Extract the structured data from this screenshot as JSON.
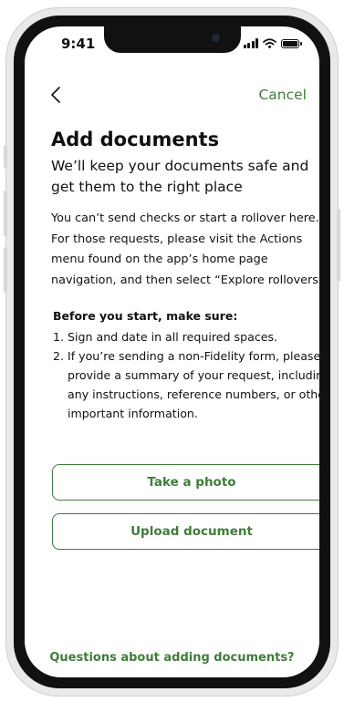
{
  "status_bar": {
    "time": "9:41",
    "icons": [
      "cellular-signal-icon",
      "wifi-icon",
      "battery-icon"
    ]
  },
  "nav": {
    "back_icon": "chevron-left-icon",
    "cancel_label": "Cancel"
  },
  "header": {
    "title": "Add documents",
    "subtitle": "We’ll keep your documents safe and get them to the right place"
  },
  "info": {
    "text": "You can’t send checks or start a rollover here. For those requests, please visit the Actions menu found on the app’s home page navigation, and then select “Explore rollovers.”"
  },
  "checklist": {
    "heading": "Before you start, make sure:",
    "items": [
      {
        "number": "1.",
        "text": "Sign and date in all required spaces."
      },
      {
        "number": "2.",
        "text": "If you’re sending a non-Fidelity form, please provide a summary of your request, including any instructions, reference numbers, or other important information."
      }
    ]
  },
  "actions": {
    "take_photo_label": "Take a photo",
    "upload_label": "Upload document"
  },
  "footer": {
    "help_link": "Questions about adding documents?"
  },
  "colors": {
    "accent": "#3f7d3a",
    "text": "#111111",
    "background": "#ffffff"
  }
}
